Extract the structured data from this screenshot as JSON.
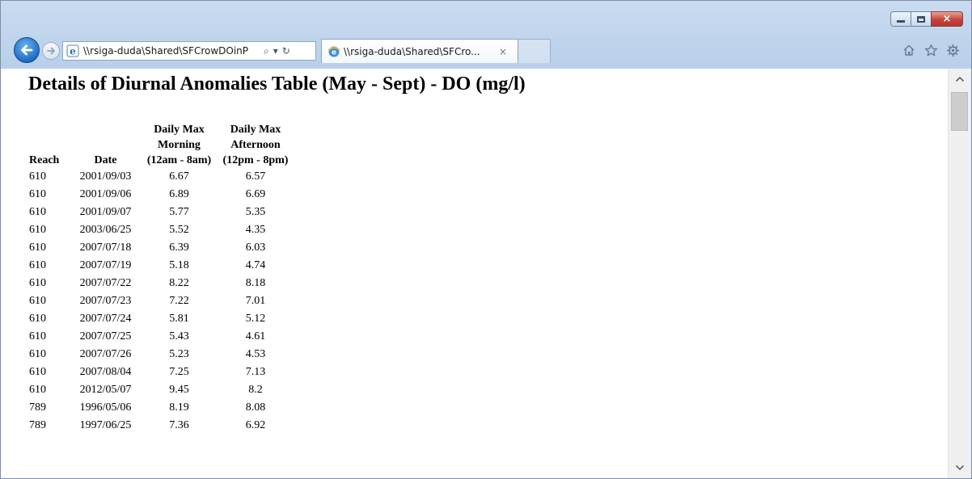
{
  "browser": {
    "address": "\\\\rsiga-duda\\Shared\\SFCrowDOinP",
    "address_search_glyph": "⌕",
    "address_dropdown_glyph": "▾",
    "address_refresh_glyph": "↻",
    "tab_title": "\\\\rsiga-duda\\Shared\\SFCro...",
    "tab_close_glyph": "×",
    "close_glyph": "×",
    "icons": [
      "back-icon",
      "forward-icon",
      "ie-icon",
      "search-icon",
      "dropdown-icon",
      "refresh-icon",
      "close-icon",
      "home-icon",
      "favorites-star-icon",
      "settings-gear-icon",
      "minimize-icon",
      "maximize-icon"
    ],
    "colors": {
      "accent": "#1c6ec6",
      "chrome": "#c9dbf0",
      "close": "#c6443b"
    }
  },
  "page": {
    "title": "Details of Diurnal Anomalies Table (May - Sept) - DO (mg/l)"
  },
  "table": {
    "headers": {
      "reach": "Reach",
      "date": "Date",
      "morning": [
        "Daily Max",
        "Morning",
        "(12am - 8am)"
      ],
      "afternoon": [
        "Daily Max",
        "Afternoon",
        "(12pm - 8pm)"
      ]
    },
    "rows": [
      [
        "610",
        "2001/09/03",
        "6.67",
        "6.57"
      ],
      [
        "610",
        "2001/09/06",
        "6.89",
        "6.69"
      ],
      [
        "610",
        "2001/09/07",
        "5.77",
        "5.35"
      ],
      [
        "610",
        "2003/06/25",
        "5.52",
        "4.35"
      ],
      [
        "610",
        "2007/07/18",
        "6.39",
        "6.03"
      ],
      [
        "610",
        "2007/07/19",
        "5.18",
        "4.74"
      ],
      [
        "610",
        "2007/07/22",
        "8.22",
        "8.18"
      ],
      [
        "610",
        "2007/07/23",
        "7.22",
        "7.01"
      ],
      [
        "610",
        "2007/07/24",
        "5.81",
        "5.12"
      ],
      [
        "610",
        "2007/07/25",
        "5.43",
        "4.61"
      ],
      [
        "610",
        "2007/07/26",
        "5.23",
        "4.53"
      ],
      [
        "610",
        "2007/08/04",
        "7.25",
        "7.13"
      ],
      [
        "610",
        "2012/05/07",
        "9.45",
        "8.2"
      ],
      [
        "789",
        "1996/05/06",
        "8.19",
        "8.08"
      ],
      [
        "789",
        "1997/06/25",
        "7.36",
        "6.92"
      ]
    ]
  }
}
